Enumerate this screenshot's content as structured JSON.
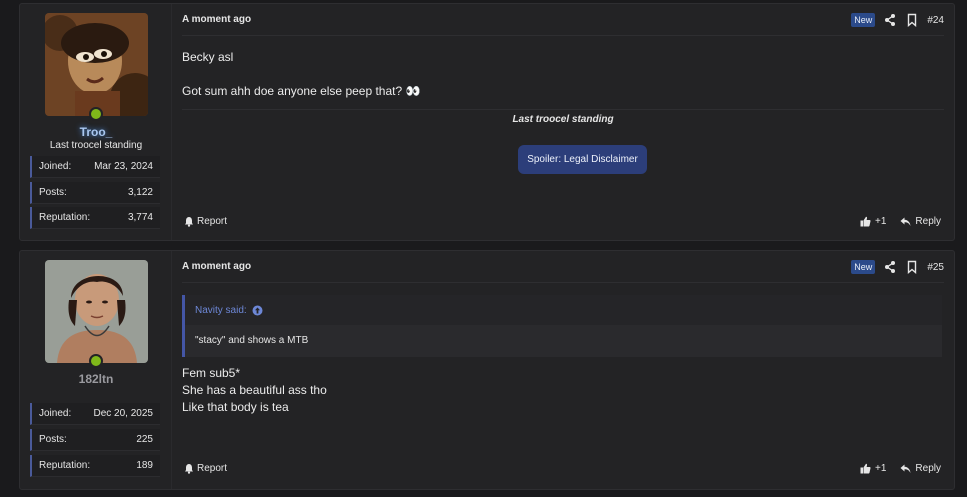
{
  "posts": [
    {
      "timestamp": "A moment ago",
      "badge": "New",
      "number": "#24",
      "user": {
        "name": "Troo_",
        "title": "Last troocel standing",
        "stats": [
          {
            "label": "Joined:",
            "value": "Mar 23, 2024"
          },
          {
            "label": "Posts:",
            "value": "3,122"
          },
          {
            "label": "Reputation:",
            "value": "3,774"
          }
        ]
      },
      "message_lines": [
        "Becky asl",
        "Got sum ahh doe anyone else peep that? 👀"
      ],
      "signature": "Last troocel standing",
      "spoiler_label": "Spoiler: Legal Disclaimer",
      "report_label": "Report",
      "like_count": "+1",
      "reply_label": "Reply"
    },
    {
      "timestamp": "A moment ago",
      "badge": "New",
      "number": "#25",
      "user": {
        "name": "182ltn",
        "stats": [
          {
            "label": "Joined:",
            "value": "Dec 20, 2025"
          },
          {
            "label": "Posts:",
            "value": "225"
          },
          {
            "label": "Reputation:",
            "value": "189"
          }
        ]
      },
      "quote": {
        "author": "Navity said:",
        "text": "\"stacy\" and shows a MTB"
      },
      "message_lines": [
        "Fem sub5*",
        "She has a beautiful ass tho",
        "Like that body is tea"
      ],
      "report_label": "Report",
      "like_count": "+1",
      "reply_label": "Reply"
    }
  ],
  "icons": {
    "share": "share-icon",
    "bookmark": "bookmark-icon",
    "report": "bell-icon",
    "like": "thumbs-up-icon",
    "reply": "reply-icon",
    "quote_up": "arrow-up-circle-icon"
  },
  "colors": {
    "background": "#1a1a1c",
    "panel": "#232325",
    "accent": "#2c3e7a",
    "new_badge": "#2b4a8a",
    "online": "#7fb81a"
  }
}
